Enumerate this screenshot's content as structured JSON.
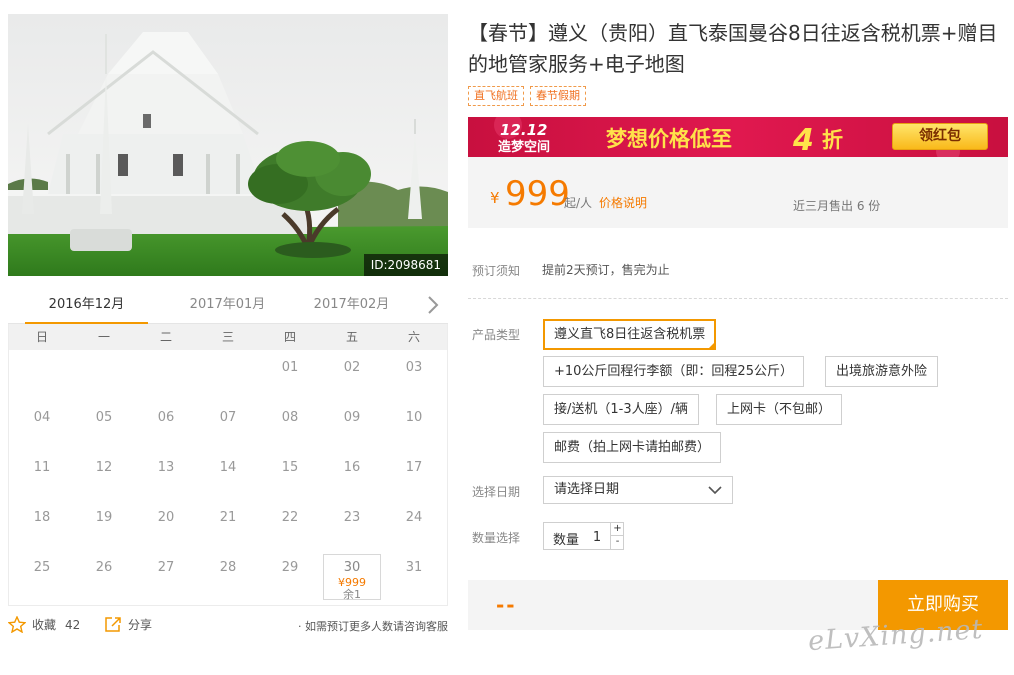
{
  "hero": {
    "image_id": "ID:2098681"
  },
  "calendar": {
    "months": [
      "2016年12月",
      "2017年01月",
      "2017年02月"
    ],
    "weekdays": [
      "日",
      "一",
      "二",
      "三",
      "四",
      "五",
      "六"
    ],
    "days": [
      "01",
      "02",
      "03",
      "04",
      "05",
      "06",
      "07",
      "08",
      "09",
      "10",
      "11",
      "12",
      "13",
      "14",
      "15",
      "16",
      "17",
      "18",
      "19",
      "20",
      "21",
      "22",
      "23",
      "24",
      "25",
      "26",
      "27",
      "28",
      "29",
      "30",
      "31"
    ],
    "available": {
      "day": "30",
      "price": "¥999",
      "stock": "余1"
    }
  },
  "actions": {
    "favorite_label": "收藏",
    "favorite_count": "42",
    "share_label": "分享",
    "consult_text": "· 如需预订更多人数请咨询客服"
  },
  "product": {
    "title": "【春节】遵义（贵阳）直飞泰国曼谷8日往返含税机票+赠目的地管家服务+电子地图",
    "tags": [
      "直飞航班",
      "春节假期"
    ]
  },
  "banner": {
    "slogan_logo": "12.12 造梦空间",
    "text": "梦想价格低至",
    "discount": "4",
    "discount_unit": "折",
    "button": "领红包"
  },
  "price": {
    "currency": "¥",
    "amount": "999",
    "unit": "起/人",
    "note": "价格说明",
    "sold": "近三月售出 6 份"
  },
  "booking": {
    "notice_label": "预订须知",
    "notice_text": "提前2天预订，售完为止",
    "type_label": "产品类型",
    "options": [
      "遵义直飞8日往返含税机票",
      "+10公斤回程行李额（即：回程25公斤）",
      "出境旅游意外险",
      "接/送机（1-3人座）/辆",
      "上网卡（不包邮）",
      "邮费（拍上网卡请拍邮费）"
    ],
    "date_label": "选择日期",
    "date_placeholder": "请选择日期",
    "qty_label_row": "数量选择",
    "qty_label": "数量",
    "qty_value": "1",
    "qty_plus": "+",
    "qty_minus": "-",
    "total": "--",
    "buy_button": "立即购买"
  },
  "watermark": "eLvXing.net",
  "colors": {
    "accent": "#f39800",
    "price": "#f57a00",
    "banner": "#d6164b"
  }
}
